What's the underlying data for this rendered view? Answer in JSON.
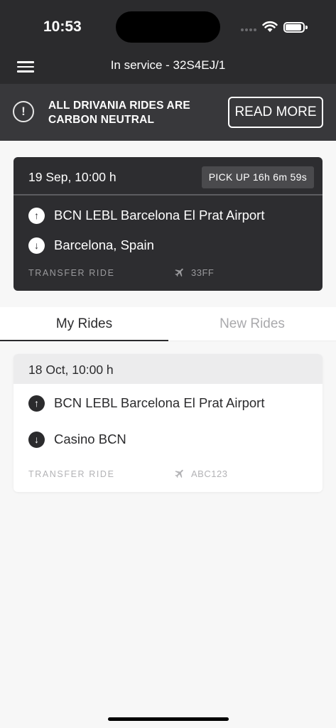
{
  "status_bar": {
    "time": "10:53"
  },
  "nav": {
    "title": "In service - 32S4EJ/1",
    "menu_icon": "hamburger-menu-icon"
  },
  "banner": {
    "icon": "alert-circle-icon",
    "icon_glyph": "!",
    "text": "ALL DRIVANIA RIDES ARE CARBON NEUTRAL",
    "button_label": "READ MORE"
  },
  "active_ride": {
    "date": "19 Sep, 10:00 h",
    "pickup_badge": "PICK UP 16h 6m 59s",
    "from": "BCN LEBL Barcelona El Prat Airport",
    "to": "Barcelona, Spain",
    "ride_type": "TRANSFER RIDE",
    "flight": "33FF"
  },
  "tabs": [
    {
      "label": "My Rides",
      "active": true
    },
    {
      "label": "New Rides",
      "active": false
    }
  ],
  "rides": [
    {
      "date": "18 Oct, 10:00 h",
      "from": "BCN LEBL Barcelona El Prat Airport",
      "to": "Casino BCN",
      "ride_type": "TRANSFER RIDE",
      "flight": "ABC123"
    }
  ],
  "icons": {
    "up": "↑",
    "down": "↓",
    "airplane": "airplane-icon"
  },
  "colors": {
    "header_bg": "#2b2b2d",
    "banner_bg": "#38383b",
    "card_dark": "#2d2d30",
    "page_bg": "#f7f7f7"
  }
}
